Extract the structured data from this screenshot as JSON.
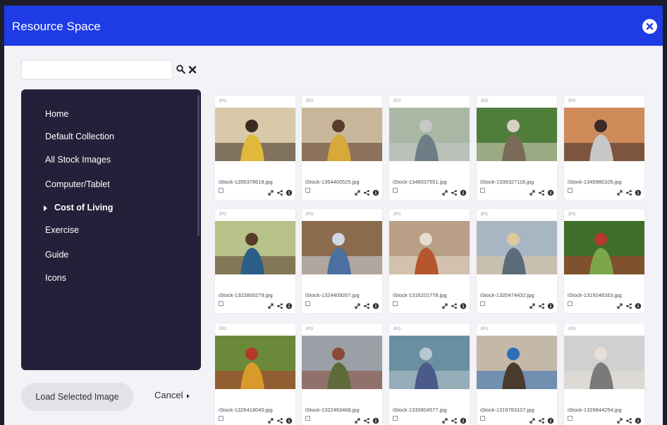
{
  "dialog": {
    "title": "Resource Space",
    "close_icon": "close-circle-icon",
    "brand_color": "#1f3be6"
  },
  "search": {
    "value": "",
    "placeholder": "",
    "search_icon": "magnifier-icon",
    "clear_icon": "x-icon"
  },
  "sidebar": {
    "items": [
      {
        "label": "Home"
      },
      {
        "label": "Default Collection"
      },
      {
        "label": "All Stock Images"
      },
      {
        "label": "Computer/Tablet"
      },
      {
        "label": "Cost of Living",
        "active": true
      },
      {
        "label": "Exercise"
      },
      {
        "label": "Guide"
      },
      {
        "label": "Icons"
      }
    ]
  },
  "footer": {
    "load_label": "Load Selected Image",
    "cancel_label": "Cancel"
  },
  "images": [
    {
      "format": "JPG",
      "filename": "iStock-1356378618.jpg"
    },
    {
      "format": "JPG",
      "filename": "iStock-1354400525.jpg"
    },
    {
      "format": "JPG",
      "filename": "iStock-1346037551.jpg"
    },
    {
      "format": "JPG",
      "filename": "iStock-1339327118.jpg"
    },
    {
      "format": "JPG",
      "filename": "iStock-1345980105.jpg"
    },
    {
      "format": "JPG",
      "filename": "iStock-1322800279.jpg"
    },
    {
      "format": "JPG",
      "filename": "iStock-1324409267.jpg"
    },
    {
      "format": "JPG",
      "filename": "iStock-1316201778.jpg"
    },
    {
      "format": "JPG",
      "filename": "iStock-1320474432.jpg"
    },
    {
      "format": "JPG",
      "filename": "iStock-1319248163.jpg"
    },
    {
      "format": "JPG",
      "filename": "iStock-1326418040.jpg"
    },
    {
      "format": "JPG",
      "filename": "iStock-1322493468.jpg"
    },
    {
      "format": "JPG",
      "filename": "iStock-1333904577.jpg"
    },
    {
      "format": "JPG",
      "filename": "iStock-1319783107.jpg"
    },
    {
      "format": "JPG",
      "filename": "iStock-1329844254.jpg"
    }
  ],
  "card_action_icons": [
    "expand-icon",
    "share-icon",
    "info-icon"
  ]
}
